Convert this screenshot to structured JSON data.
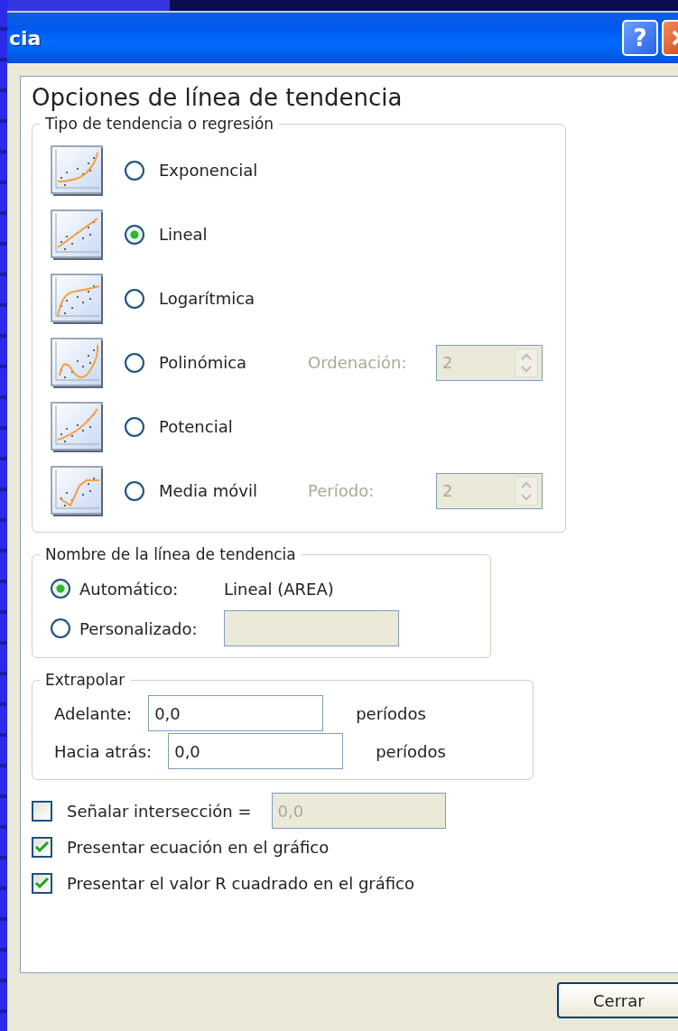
{
  "window": {
    "title": "cia",
    "buttons": [
      {
        "kind": "help",
        "label": "?"
      },
      {
        "kind": "close"
      }
    ]
  },
  "heading": "Opciones de línea de tendencia",
  "trend_type": {
    "legend": "Tipo de tendencia o regresión",
    "options": [
      {
        "kind": "exponential",
        "label": "Exponencial",
        "selected": false
      },
      {
        "kind": "linear",
        "label": "Lineal",
        "selected": true
      },
      {
        "kind": "logarithmic",
        "label": "Logarítmica",
        "selected": false
      },
      {
        "kind": "polynomial",
        "label": "Polinómica",
        "selected": false,
        "setting": {
          "label": "Ordenación:",
          "value": "2",
          "disabled": true
        }
      },
      {
        "kind": "power",
        "label": "Potencial",
        "selected": false
      },
      {
        "kind": "moving_average",
        "label": "Media móvil",
        "selected": false,
        "setting": {
          "label": "Período:",
          "value": "2",
          "disabled": true
        }
      }
    ]
  },
  "trend_name": {
    "legend": "Nombre de la línea de tendencia",
    "options": [
      {
        "label": "Automático:",
        "selected": true,
        "value": "Lineal (AREA)"
      },
      {
        "label": "Personalizado:",
        "selected": false,
        "input": {
          "disabled": true
        }
      }
    ]
  },
  "extrapolate": {
    "legend": "Extrapolar",
    "rows": [
      {
        "label": "Adelante:",
        "value": "0,0",
        "unit": "períodos"
      },
      {
        "label": "Hacia atrás:",
        "value": "0,0",
        "unit": "períodos"
      }
    ]
  },
  "checks": [
    {
      "label": "Señalar intersección =",
      "checked": false,
      "field": {
        "value": "0,0",
        "disabled": true
      }
    },
    {
      "label": "Presentar ecuación en el gráfico",
      "checked": true
    },
    {
      "label": "Presentar el valor R cuadrado en el gráfico",
      "checked": true
    }
  ],
  "close_button": "Cerrar"
}
